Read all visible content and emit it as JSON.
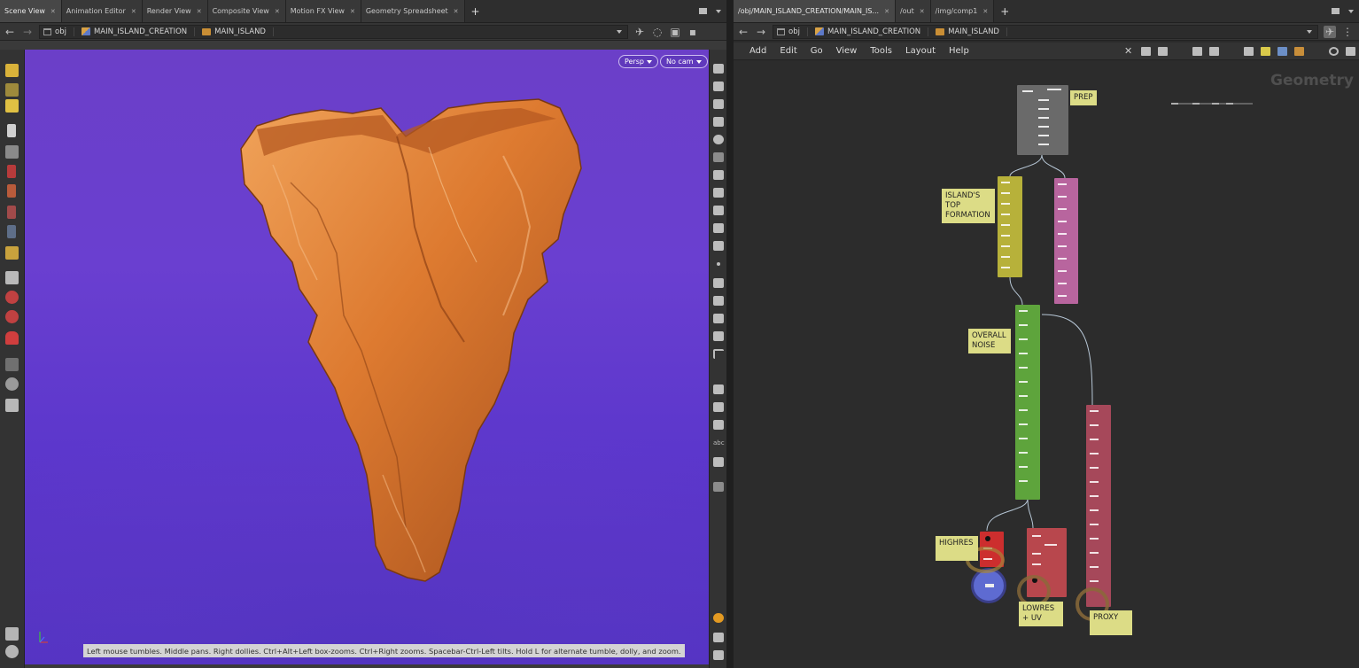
{
  "left": {
    "tabs": [
      {
        "label": "Scene View",
        "active": true
      },
      {
        "label": "Animation Editor"
      },
      {
        "label": "Render View"
      },
      {
        "label": "Composite View"
      },
      {
        "label": "Motion FX View"
      },
      {
        "label": "Geometry Spreadsheet"
      }
    ],
    "path": {
      "root": "obj",
      "level1": "MAIN_ISLAND_CREATION",
      "level2": "MAIN_ISLAND"
    },
    "viewport": {
      "persp_label": "Persp",
      "cam_label": "No cam",
      "hint": "Left mouse tumbles. Middle pans. Right dollies. Ctrl+Alt+Left box-zooms. Ctrl+Right zooms. Spacebar-Ctrl-Left tilts. Hold L for alternate tumble, dolly, and zoom.",
      "background_colors": [
        "#6b3fc8",
        "#4e30c2"
      ],
      "island_color": "#d9782f"
    }
  },
  "right": {
    "tabs": [
      {
        "label": "/obj/MAIN_ISLAND_CREATION/MAIN_IS...",
        "active": true
      },
      {
        "label": "/out"
      },
      {
        "label": "/img/comp1"
      }
    ],
    "path": {
      "root": "obj",
      "level1": "MAIN_ISLAND_CREATION",
      "level2": "MAIN_ISLAND"
    },
    "menu": [
      "Add",
      "Edit",
      "Go",
      "View",
      "Tools",
      "Layout",
      "Help"
    ],
    "network_label": "Geometry",
    "notes": {
      "prep": "PREP",
      "top_formation": "ISLAND'S TOP FORMATION",
      "overall_noise": "OVERALL NOISE",
      "highres": "HIGHRES",
      "lowres": "LOWRES + UV",
      "proxy": "PROXY"
    },
    "colors": {
      "prep": "#6a6a6a",
      "top": "#b7b13a",
      "pink": "#b8659e",
      "noise": "#5ea43c",
      "red": "#cc2e2e",
      "lowres": "#b8474d",
      "proxy": "#a6485a"
    }
  }
}
